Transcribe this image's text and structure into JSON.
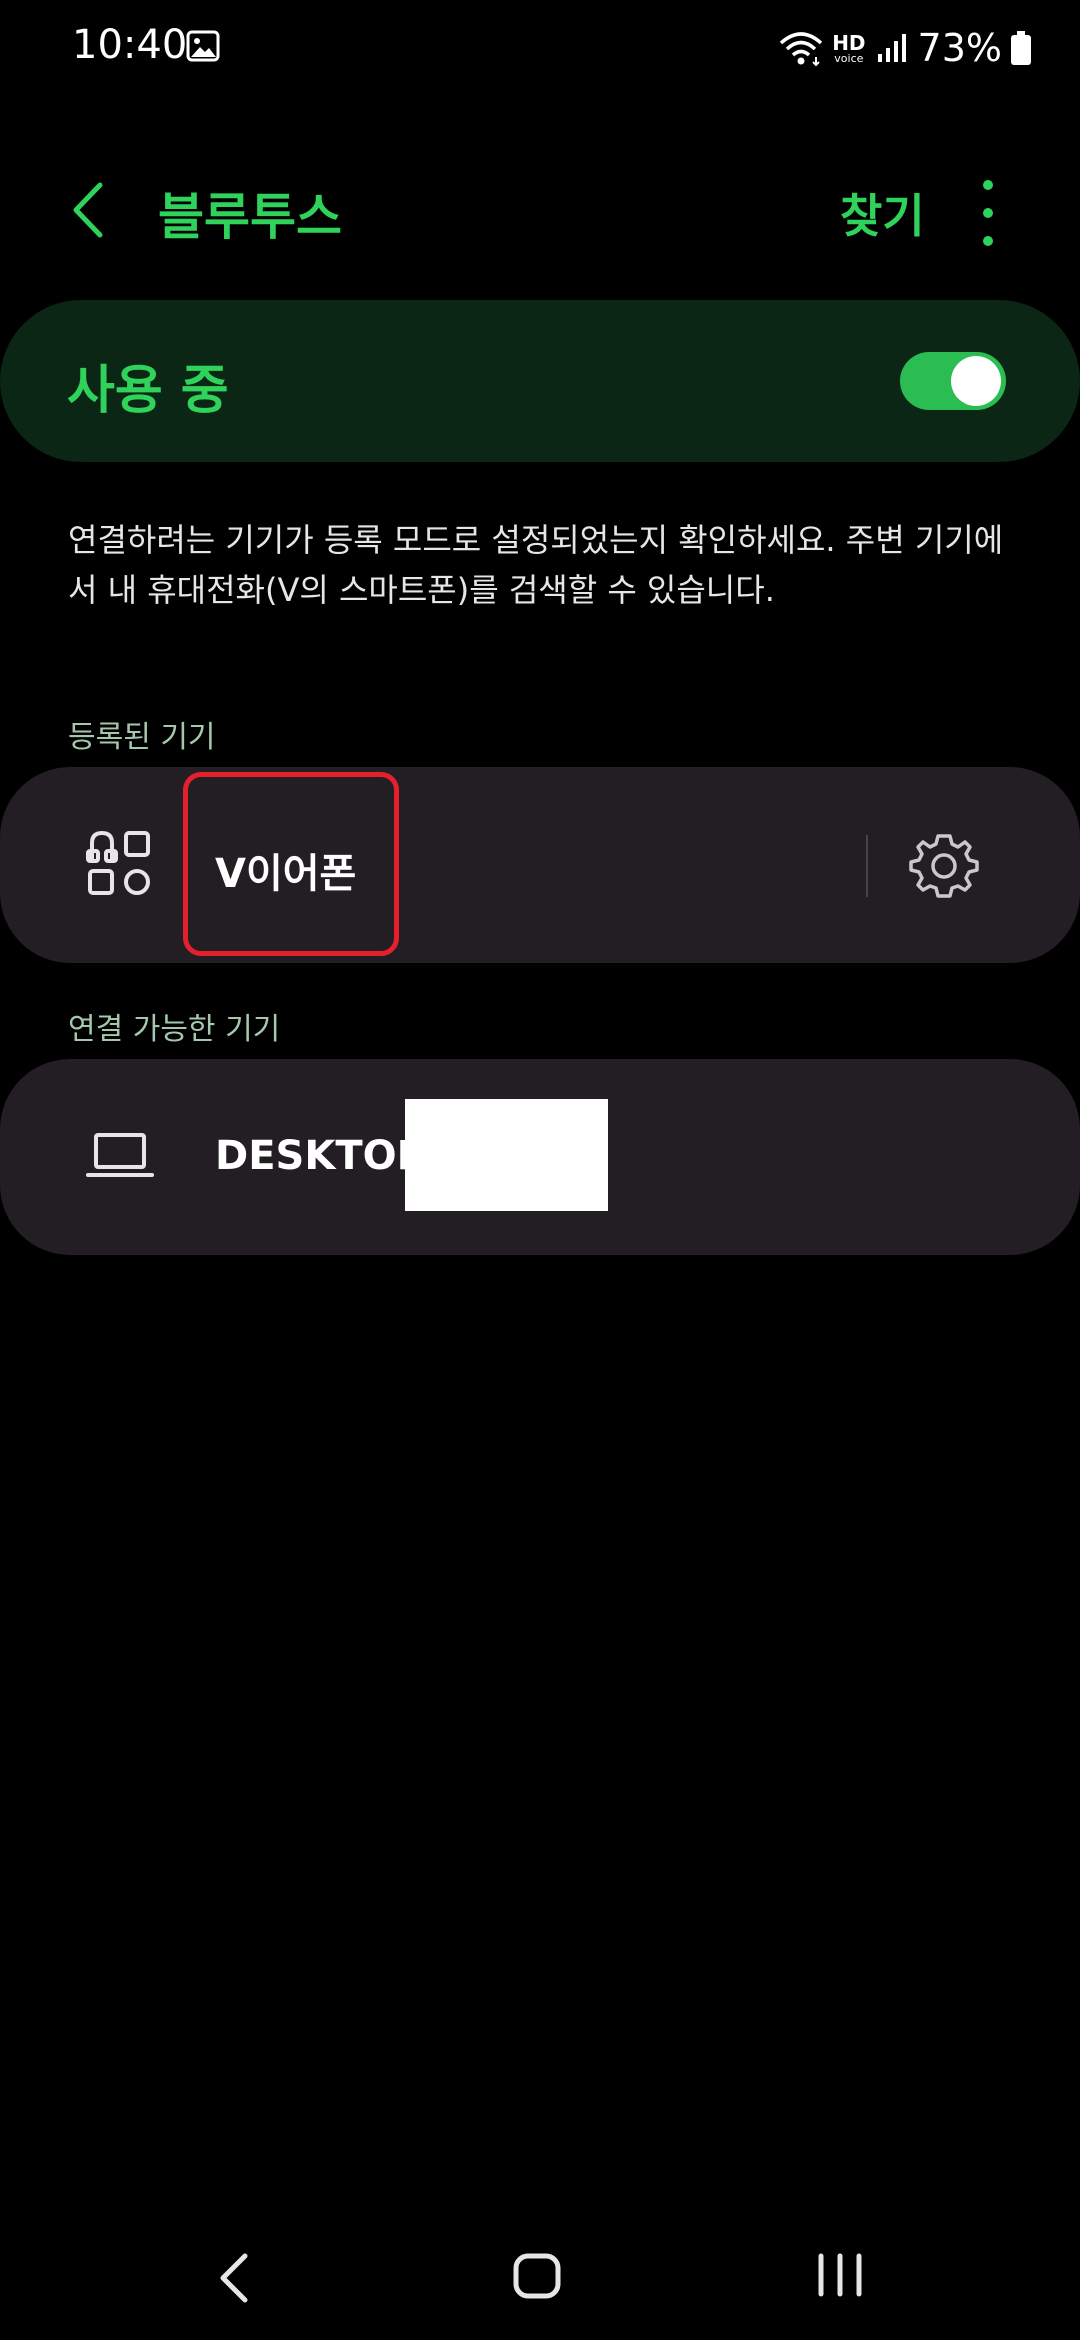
{
  "status_bar": {
    "time": "10:40",
    "hd_label": "HD",
    "voice_label": "voice",
    "battery": "73%"
  },
  "app_bar": {
    "title": "블루투스",
    "search_label": "찾기"
  },
  "master_switch": {
    "label": "사용 중",
    "on": true,
    "accent": "#2fd25b"
  },
  "description": "연결하려는 기기가 등록 모드로 설정되었는지 확인하세요. 주변 기기에서 내 휴대전화(V의 스마트폰)를 검색할 수 있습니다.",
  "paired_section": {
    "header": "등록된 기기",
    "devices": [
      {
        "name": "V이어폰",
        "icon": "earbuds-icon"
      }
    ]
  },
  "available_section": {
    "header": "연결 가능한 기기",
    "devices": [
      {
        "name": "DESKTOP-",
        "icon": "laptop-icon"
      }
    ]
  }
}
